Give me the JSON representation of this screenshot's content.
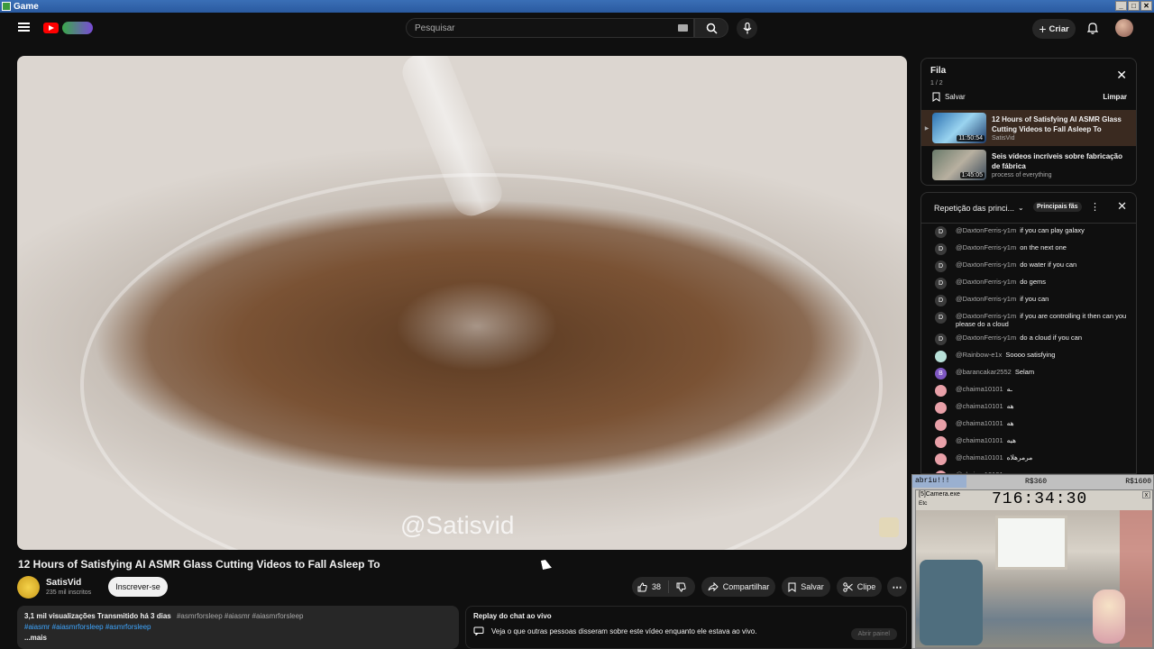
{
  "window": {
    "title": "Game",
    "controls": [
      "_",
      "□",
      "✕"
    ]
  },
  "header": {
    "search_placeholder": "Pesquisar",
    "create_label": "Criar"
  },
  "video": {
    "watermark": "@Satisvid",
    "title": "12 Hours of Satisfying AI ASMR Glass Cutting Videos to Fall Asleep To"
  },
  "channel": {
    "name": "SatisVid",
    "subscribers": "235 mil inscritos",
    "subscribe_label": "Inscrever-se"
  },
  "actions": {
    "likes": "38",
    "share_label": "Compartilhar",
    "save_label": "Salvar",
    "clip_label": "Clipe"
  },
  "description": {
    "stats": "3,1 mil visualizações  Transmitido há 3 dias",
    "hashtags_inline": "#asmrforsleep #aiasmr #aiasmrforsleep",
    "hashtags_line2": "#aiasmr #aiasmrforsleep #asmrforsleep",
    "more": "...mais"
  },
  "chat_replay": {
    "title": "Replay do chat ao vivo",
    "text": "Veja o que outras pessoas disseram sobre este vídeo enquanto ele estava ao vivo.",
    "open_label": "Abrir painel"
  },
  "queue": {
    "title": "Fila",
    "count": "1 / 2",
    "save_label": "Salvar",
    "clear_label": "Limpar",
    "items": [
      {
        "title": "12 Hours of Satisfying AI ASMR Glass Cutting Videos to Fall Asleep To",
        "channel": "SatisVid",
        "duration": "11:50:54"
      },
      {
        "title": "Seis vídeos incríveis sobre fabricação de fábrica",
        "channel": "process of everything",
        "duration": "1:45:05"
      }
    ]
  },
  "chat": {
    "mode_label": "Repetição das princi...",
    "badge_label": "Principais fãs",
    "messages": [
      {
        "avatar": "D",
        "author": "@DaxtonFerris-y1m",
        "text": "if you can play galaxy",
        "color": "#3a3a3a"
      },
      {
        "avatar": "D",
        "author": "@DaxtonFerris-y1m",
        "text": "on the next one",
        "color": "#3a3a3a"
      },
      {
        "avatar": "D",
        "author": "@DaxtonFerris-y1m",
        "text": "do water if you can",
        "color": "#3a3a3a"
      },
      {
        "avatar": "D",
        "author": "@DaxtonFerris-y1m",
        "text": "do gems",
        "color": "#3a3a3a"
      },
      {
        "avatar": "D",
        "author": "@DaxtonFerris-y1m",
        "text": "if you can",
        "color": "#3a3a3a"
      },
      {
        "avatar": "D",
        "author": "@DaxtonFerris-y1m",
        "text": "if you are controlling it then can you please do a cloud",
        "color": "#3a3a3a"
      },
      {
        "avatar": "D",
        "author": "@DaxtonFerris-y1m",
        "text": "do a cloud if you can",
        "color": "#3a3a3a"
      },
      {
        "avatar": "",
        "author": "@Rainbow-e1x",
        "text": "Soooo satisfying",
        "color": "#b8e0d8"
      },
      {
        "avatar": "B",
        "author": "@barancakar2552",
        "text": "Selam",
        "color": "#7e57c2"
      },
      {
        "avatar": "",
        "author": "@chaima10101",
        "text": "ـه",
        "color": "#e8a0a8"
      },
      {
        "avatar": "",
        "author": "@chaima10101",
        "text": "هه",
        "color": "#e8a0a8"
      },
      {
        "avatar": "",
        "author": "@chaima10101",
        "text": "هه",
        "color": "#e8a0a8"
      },
      {
        "avatar": "",
        "author": "@chaima10101",
        "text": "هيه",
        "color": "#e8a0a8"
      },
      {
        "avatar": "",
        "author": "@chaima10101",
        "text": "مرمرهلاه",
        "color": "#e8a0a8"
      },
      {
        "avatar": "",
        "author": "@chaima10101",
        "text": "ـه",
        "color": "#e8a0a8"
      }
    ]
  },
  "overlay": {
    "status": "abriu!!!",
    "value1": "R$360",
    "value2": "R$1600",
    "cam_title": "[5]Camera.exe",
    "cam_menu": "Etc",
    "timer": "716:34:30"
  }
}
